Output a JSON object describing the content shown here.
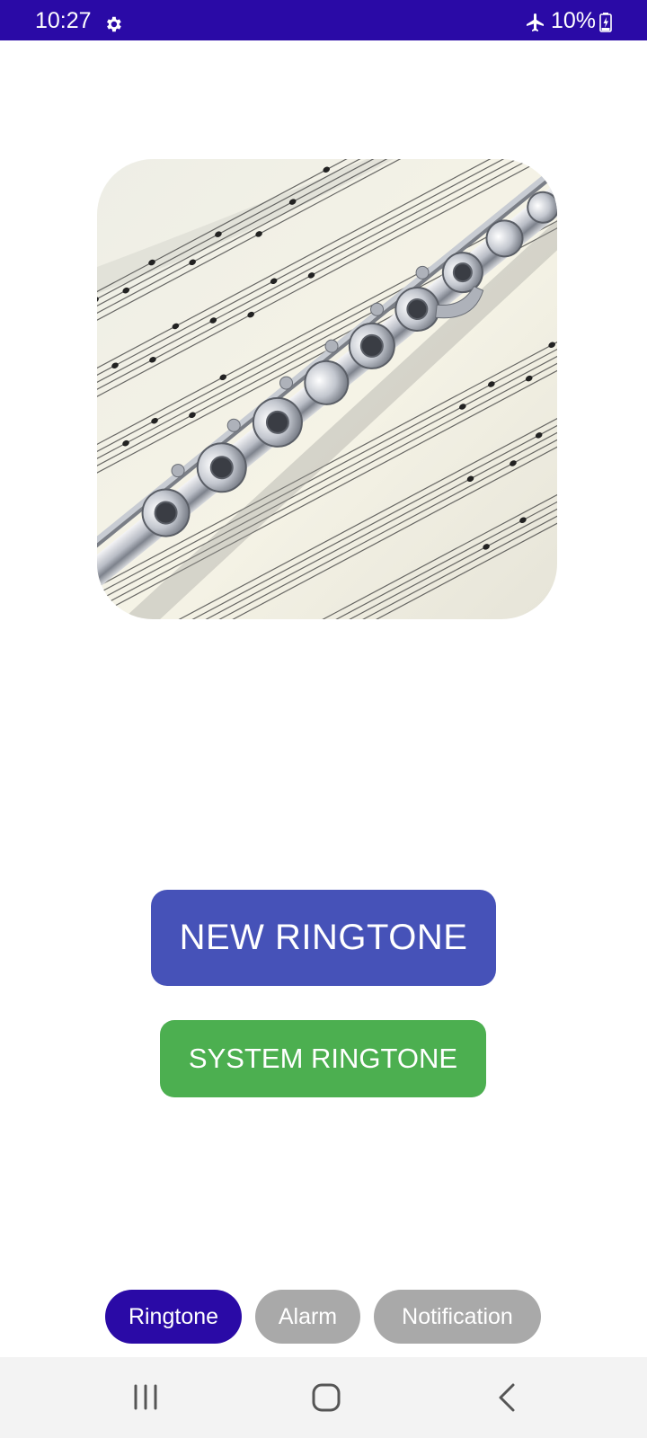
{
  "status_bar": {
    "time": "10:27",
    "battery": "10%",
    "icons": [
      "gear-icon",
      "airplane-icon",
      "battery-charging-icon"
    ],
    "background": "#2a0aa6"
  },
  "hero": {
    "image_name": "flute-on-sheet-music-image"
  },
  "buttons": {
    "new_ringtone": "NEW RINGTONE",
    "system_ringtone": "SYSTEM RINGTONE"
  },
  "tabs": [
    {
      "label": "Ringtone",
      "selected": true
    },
    {
      "label": "Alarm",
      "selected": false
    },
    {
      "label": "Notification",
      "selected": false
    }
  ],
  "colors": {
    "primary": "#2a0aa6",
    "new_button": "#4652b8",
    "system_button": "#4caf50",
    "tab_inactive": "#a9a9a9"
  },
  "nav_bar": {
    "icons": [
      "recent-apps-icon",
      "home-icon",
      "back-icon"
    ]
  }
}
